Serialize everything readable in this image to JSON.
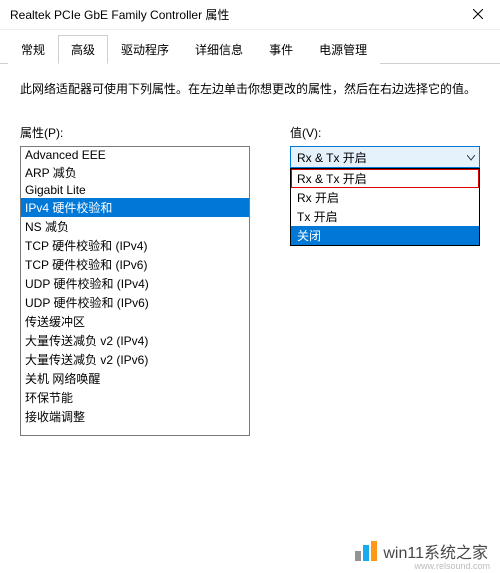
{
  "titlebar": {
    "title": "Realtek PCIe GbE Family Controller 属性"
  },
  "tabs": [
    {
      "label": "常规"
    },
    {
      "label": "高级"
    },
    {
      "label": "驱动程序"
    },
    {
      "label": "详细信息"
    },
    {
      "label": "事件"
    },
    {
      "label": "电源管理"
    }
  ],
  "active_tab_index": 1,
  "description": "此网络适配器可使用下列属性。在左边单击你想更改的属性，然后在右边选择它的值。",
  "property_label": "属性(P):",
  "value_label": "值(V):",
  "properties": [
    "Advanced EEE",
    "ARP 减负",
    "Gigabit Lite",
    "IPv4 硬件校验和",
    "NS 减负",
    "TCP 硬件校验和 (IPv4)",
    "TCP 硬件校验和 (IPv6)",
    "UDP 硬件校验和 (IPv4)",
    "UDP 硬件校验和 (IPv6)",
    "传送缓冲区",
    "大量传送减负 v2 (IPv4)",
    "大量传送减负 v2 (IPv6)",
    "关机 网络唤醒",
    "环保节能",
    "接收端调整"
  ],
  "selected_property_index": 3,
  "combo": {
    "selected": "Rx & Tx 开启",
    "options": [
      "Rx & Tx 开启",
      "Rx 开启",
      "Tx 开启",
      "关闭"
    ],
    "red_highlight_index": 0,
    "blue_highlight_index": 3
  },
  "watermark": {
    "text": "win11系统之家",
    "url": "www.relsound.com"
  }
}
